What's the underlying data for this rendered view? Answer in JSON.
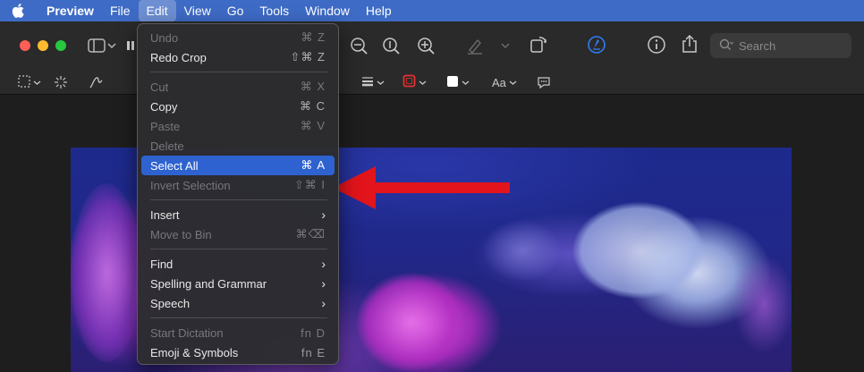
{
  "menubar": {
    "apple_icon": "apple-icon",
    "app_name": "Preview",
    "items": [
      "File",
      "Edit",
      "View",
      "Go",
      "Tools",
      "Window",
      "Help"
    ],
    "active": "Edit"
  },
  "toolbar": {
    "search_placeholder": "Search"
  },
  "markup": {
    "text_style_label": "Aa"
  },
  "edit_menu": {
    "undo": {
      "label": "Undo",
      "shortcut": "⌘ Z"
    },
    "redo": {
      "label": "Redo Crop",
      "shortcut": "⇧⌘ Z"
    },
    "cut": {
      "label": "Cut",
      "shortcut": "⌘ X"
    },
    "copy": {
      "label": "Copy",
      "shortcut": "⌘ C"
    },
    "paste": {
      "label": "Paste",
      "shortcut": "⌘ V"
    },
    "delete": {
      "label": "Delete"
    },
    "select_all": {
      "label": "Select All",
      "shortcut": "⌘ A"
    },
    "invert_selection": {
      "label": "Invert Selection",
      "shortcut": "⇧⌘ I"
    },
    "insert": {
      "label": "Insert"
    },
    "move_to_bin": {
      "label": "Move to Bin",
      "shortcut": "⌘⌫"
    },
    "find": {
      "label": "Find"
    },
    "spelling": {
      "label": "Spelling and Grammar"
    },
    "speech": {
      "label": "Speech"
    },
    "start_dictation": {
      "label": "Start Dictation",
      "shortcut": "fn D"
    },
    "emoji": {
      "label": "Emoji & Symbols",
      "shortcut": "fn E"
    }
  },
  "colors": {
    "menubar": "#3e6bc5",
    "highlight": "#2e62d0",
    "arrow": "#e3141b"
  }
}
